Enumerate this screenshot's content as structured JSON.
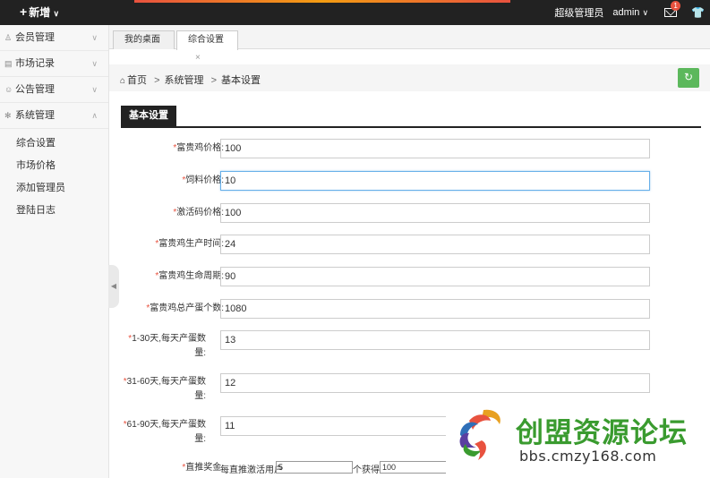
{
  "topbar": {
    "add_label": "新增",
    "role": "超级管理员",
    "user": "admin",
    "mail_badge": "1",
    "accent": "#e8523f"
  },
  "sidebar": {
    "items": [
      {
        "label": "会员管理",
        "icon": "user-icon"
      },
      {
        "label": "市场记录",
        "icon": "chart-icon"
      },
      {
        "label": "公告管理",
        "icon": "comment-icon"
      },
      {
        "label": "系统管理",
        "icon": "gear-icon"
      }
    ],
    "subitems": [
      "综合设置",
      "市场价格",
      "添加管理员",
      "登陆日志"
    ]
  },
  "tabs": [
    {
      "label": "我的桌面"
    },
    {
      "label": "综合设置",
      "close": "×"
    }
  ],
  "breadcrumb": {
    "home": "首页",
    "sep": ">",
    "level2": "系统管理",
    "level3": "基本设置"
  },
  "section": {
    "title": "基本设置"
  },
  "form": {
    "required_mark": "*",
    "fields": [
      {
        "label": "富贵鸡价格:",
        "value": "100"
      },
      {
        "label": "饲料价格:",
        "value": "10"
      },
      {
        "label": "激活码价格:",
        "value": "100"
      },
      {
        "label": "富贵鸡生产时间:",
        "value": "24"
      },
      {
        "label": "富贵鸡生命周期:",
        "value": "90"
      },
      {
        "label": "富贵鸡总产蛋个数:",
        "value": "1080"
      },
      {
        "label": "1-30天,每天产蛋数量:",
        "value": "13"
      },
      {
        "label": "31-60天,每天产蛋数量:",
        "value": "12"
      },
      {
        "label": "61-90天,每天产蛋数量:",
        "value": "11"
      }
    ],
    "referral": {
      "label": "直推奖金:",
      "prefix": "每直推激活用户",
      "users_value": "5",
      "mid": "个获得",
      "reward_value": "100"
    }
  },
  "watermark": {
    "cn": "创盟资源论坛",
    "url": "bbs.cmzy168.com"
  }
}
